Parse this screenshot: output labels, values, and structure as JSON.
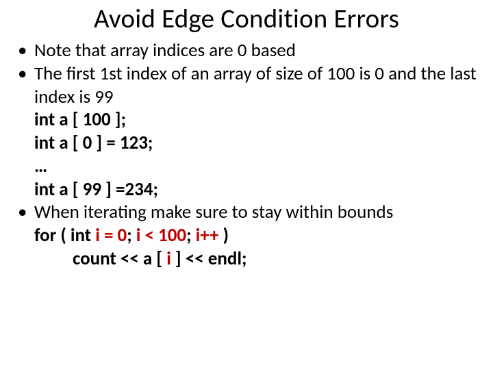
{
  "title": "Avoid Edge Condition Errors",
  "bullet1": "Note that array indices are 0 based",
  "bullet2": "The first 1st index of an array of size of 100 is 0 and the last index is 99",
  "code1": {
    "l1": "int a [ 100 ];",
    "l2": "int a [ 0 ] = 123;",
    "l3": "…",
    "l4": "int a [ 99 ] =234;"
  },
  "bullet3": "When iterating make sure to stay within bounds",
  "code2": {
    "for_kw": "for ( int ",
    "init": "i = 0",
    "sep1": "; ",
    "cond": "i < 100",
    "sep2": "; ",
    "inc": "i++",
    "close": " )",
    "body_pre": "count << a [ ",
    "body_var": "i",
    "body_post": " ] << endl;"
  }
}
